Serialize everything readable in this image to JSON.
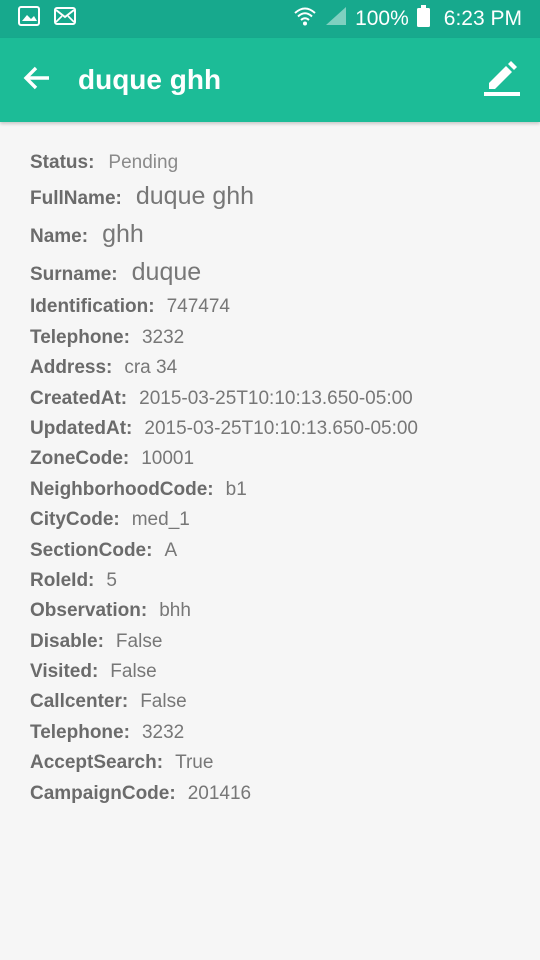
{
  "statusbar": {
    "battery": "100%",
    "time": "6:23 PM"
  },
  "appbar": {
    "title": "duque ghh"
  },
  "details": {
    "status": {
      "label": "Status:",
      "value": "Pending"
    },
    "fullname": {
      "label": "FullName:",
      "value": "duque ghh"
    },
    "name": {
      "label": "Name:",
      "value": "ghh"
    },
    "surname": {
      "label": "Surname:",
      "value": "duque"
    },
    "fields": [
      {
        "label": "Identification:",
        "value": "747474"
      },
      {
        "label": "Telephone:",
        "value": "3232"
      },
      {
        "label": "Address:",
        "value": "cra 34"
      },
      {
        "label": "CreatedAt:",
        "value": "2015-03-25T10:10:13.650-05:00"
      },
      {
        "label": "UpdatedAt:",
        "value": "2015-03-25T10:10:13.650-05:00"
      },
      {
        "label": "ZoneCode:",
        "value": "10001"
      },
      {
        "label": "NeighborhoodCode:",
        "value": "b1"
      },
      {
        "label": "CityCode:",
        "value": "med_1"
      },
      {
        "label": "SectionCode:",
        "value": "A"
      },
      {
        "label": "RoleId:",
        "value": "5"
      },
      {
        "label": "Observation:",
        "value": "bhh"
      },
      {
        "label": "Disable:",
        "value": "False"
      },
      {
        "label": "Visited:",
        "value": "False"
      },
      {
        "label": "Callcenter:",
        "value": "False"
      },
      {
        "label": "Telephone:",
        "value": "3232"
      },
      {
        "label": "AcceptSearch:",
        "value": "True"
      },
      {
        "label": "CampaignCode:",
        "value": "201416"
      }
    ]
  },
  "icons": {
    "status_image": "image-icon",
    "status_mail": "mail-icon",
    "wifi": "wifi-icon",
    "signal": "signal-icon",
    "battery": "battery-icon",
    "back": "back-arrow-icon",
    "edit": "edit-icon"
  },
  "colors": {
    "statusbar": "#17a98d",
    "appbar": "#1cbc97",
    "background": "#f6f6f6"
  }
}
